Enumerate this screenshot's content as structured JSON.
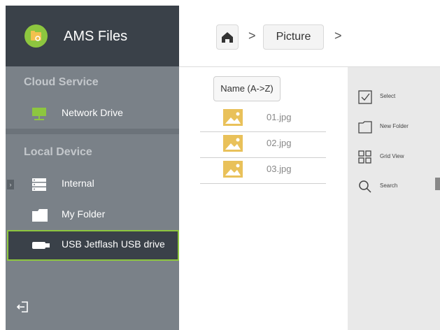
{
  "app": {
    "title": "AMS Files"
  },
  "sidebar": {
    "sections": [
      {
        "label": "Cloud Service",
        "items": [
          {
            "label": "Network Drive",
            "icon": "network-drive-icon"
          }
        ]
      },
      {
        "label": "Local Device",
        "items": [
          {
            "label": "Internal",
            "icon": "internal-storage-icon"
          },
          {
            "label": "My Folder",
            "icon": "folder-icon"
          },
          {
            "label": "USB Jetflash USB drive",
            "icon": "usb-drive-icon",
            "selected": true
          }
        ]
      }
    ],
    "exit_icon": "exit-icon"
  },
  "breadcrumb": {
    "home_icon": "home-icon",
    "items": [
      "Picture"
    ]
  },
  "file_list": {
    "sort_label": "Name (A->Z)",
    "files": [
      {
        "name": "01.jpg",
        "icon": "image-file-icon"
      },
      {
        "name": "02.jpg",
        "icon": "image-file-icon"
      },
      {
        "name": "03.jpg",
        "icon": "image-file-icon"
      }
    ]
  },
  "actions": [
    {
      "label": "Select",
      "icon": "checkbox-icon"
    },
    {
      "label": "New Folder",
      "icon": "new-folder-icon"
    },
    {
      "label": "Grid View",
      "icon": "grid-view-icon"
    },
    {
      "label": "Search",
      "icon": "search-icon"
    }
  ],
  "colors": {
    "accent": "#8dc63f",
    "sidebar_dark": "#3a4149",
    "sidebar": "#7a8188",
    "thumb": "#e9c15a"
  }
}
